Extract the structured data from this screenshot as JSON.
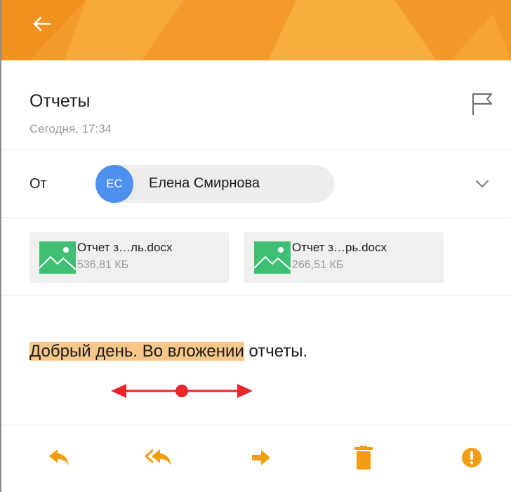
{
  "header": {
    "back_icon": "arrow-left-icon",
    "color": "#f49c2b"
  },
  "message": {
    "subject": "Отчеты",
    "date": "Сегодня, 17:34",
    "flag_icon": "flag-outline-icon"
  },
  "sender": {
    "from_label": "От",
    "initials": "ЕС",
    "name": "Елена Смирнова",
    "avatar_color": "#4d90ee",
    "expand_icon": "chevron-down-icon"
  },
  "attachments": [
    {
      "name": "Отчет з…ль.docx",
      "size": "536,81 КБ",
      "icon": "image-file-icon"
    },
    {
      "name": "Отчет з…рь.docx",
      "size": "266,51 КБ",
      "icon": "image-file-icon"
    }
  ],
  "body": {
    "selected_text": "Добрый день. Во вложении",
    "rest_text": " отчеты.",
    "highlight_color": "#f7c78a",
    "handle_color": "#e8262c"
  },
  "toolbar": {
    "accent": "#f39c12",
    "actions": [
      {
        "id": "reply",
        "icon": "reply-icon"
      },
      {
        "id": "reply_all",
        "icon": "reply-all-icon"
      },
      {
        "id": "forward",
        "icon": "forward-icon"
      },
      {
        "id": "delete",
        "icon": "trash-icon"
      },
      {
        "id": "spam",
        "icon": "alert-circle-icon"
      }
    ]
  }
}
